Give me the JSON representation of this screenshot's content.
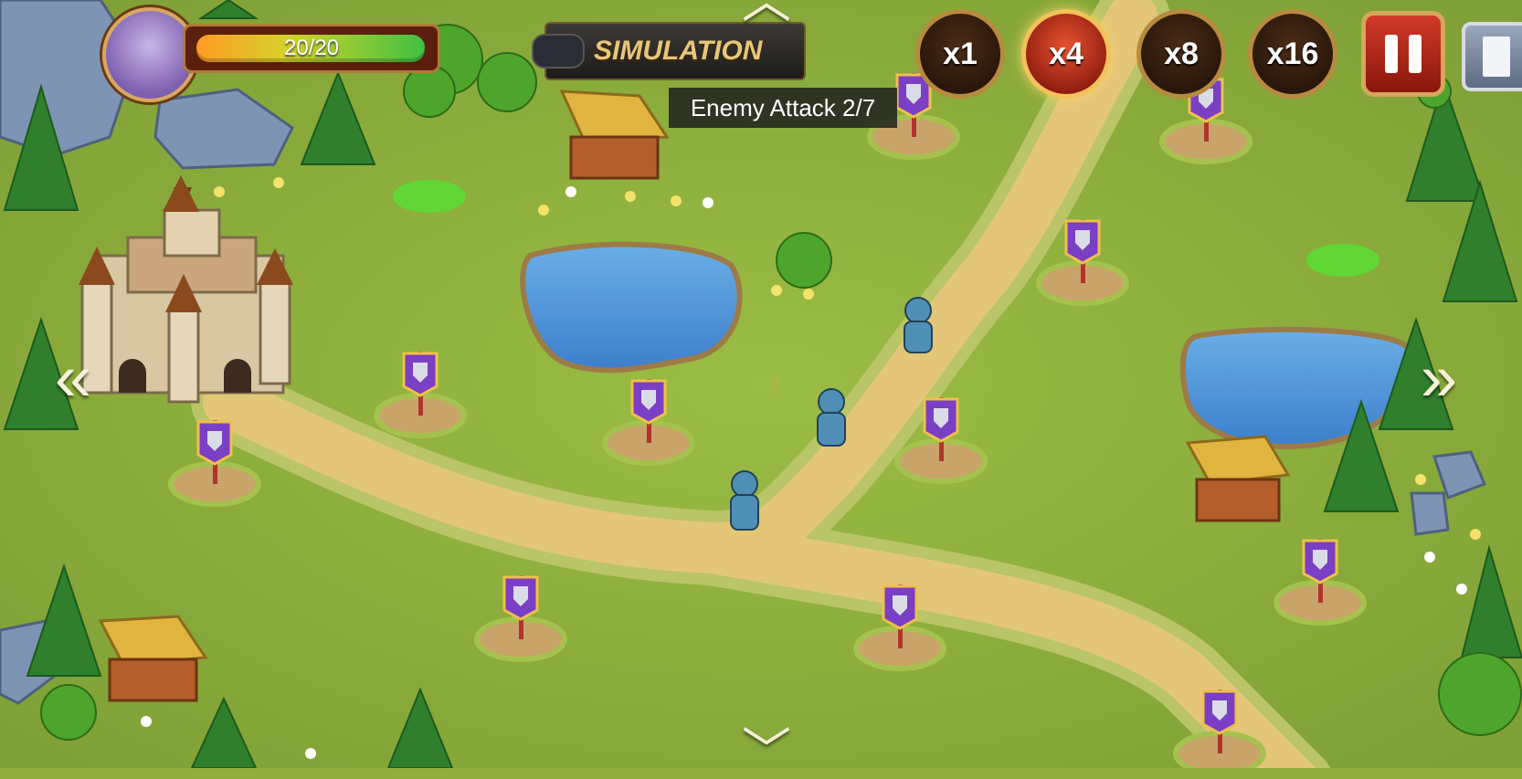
{
  "castle": {
    "hp_text": "20/20",
    "hp_fraction": 1.0
  },
  "mode": {
    "title": "SIMULATION",
    "wave_text": "Enemy Attack 2/7"
  },
  "speed_buttons": [
    {
      "label": "x1",
      "active": false
    },
    {
      "label": "x4",
      "active": true
    },
    {
      "label": "x8",
      "active": false
    },
    {
      "label": "x16",
      "active": false
    }
  ],
  "controls": {
    "pause_icon": "pause-icon",
    "exit_icon": "exit-door-icon"
  },
  "navigation": {
    "left": "«",
    "right": "»",
    "up": "︿",
    "down": "﹀"
  },
  "path_marker": "2",
  "colors": {
    "grass": "#8fae3c",
    "path": "#e4c679",
    "water": "#4d8fd4",
    "active_speed": "#c9341f"
  }
}
